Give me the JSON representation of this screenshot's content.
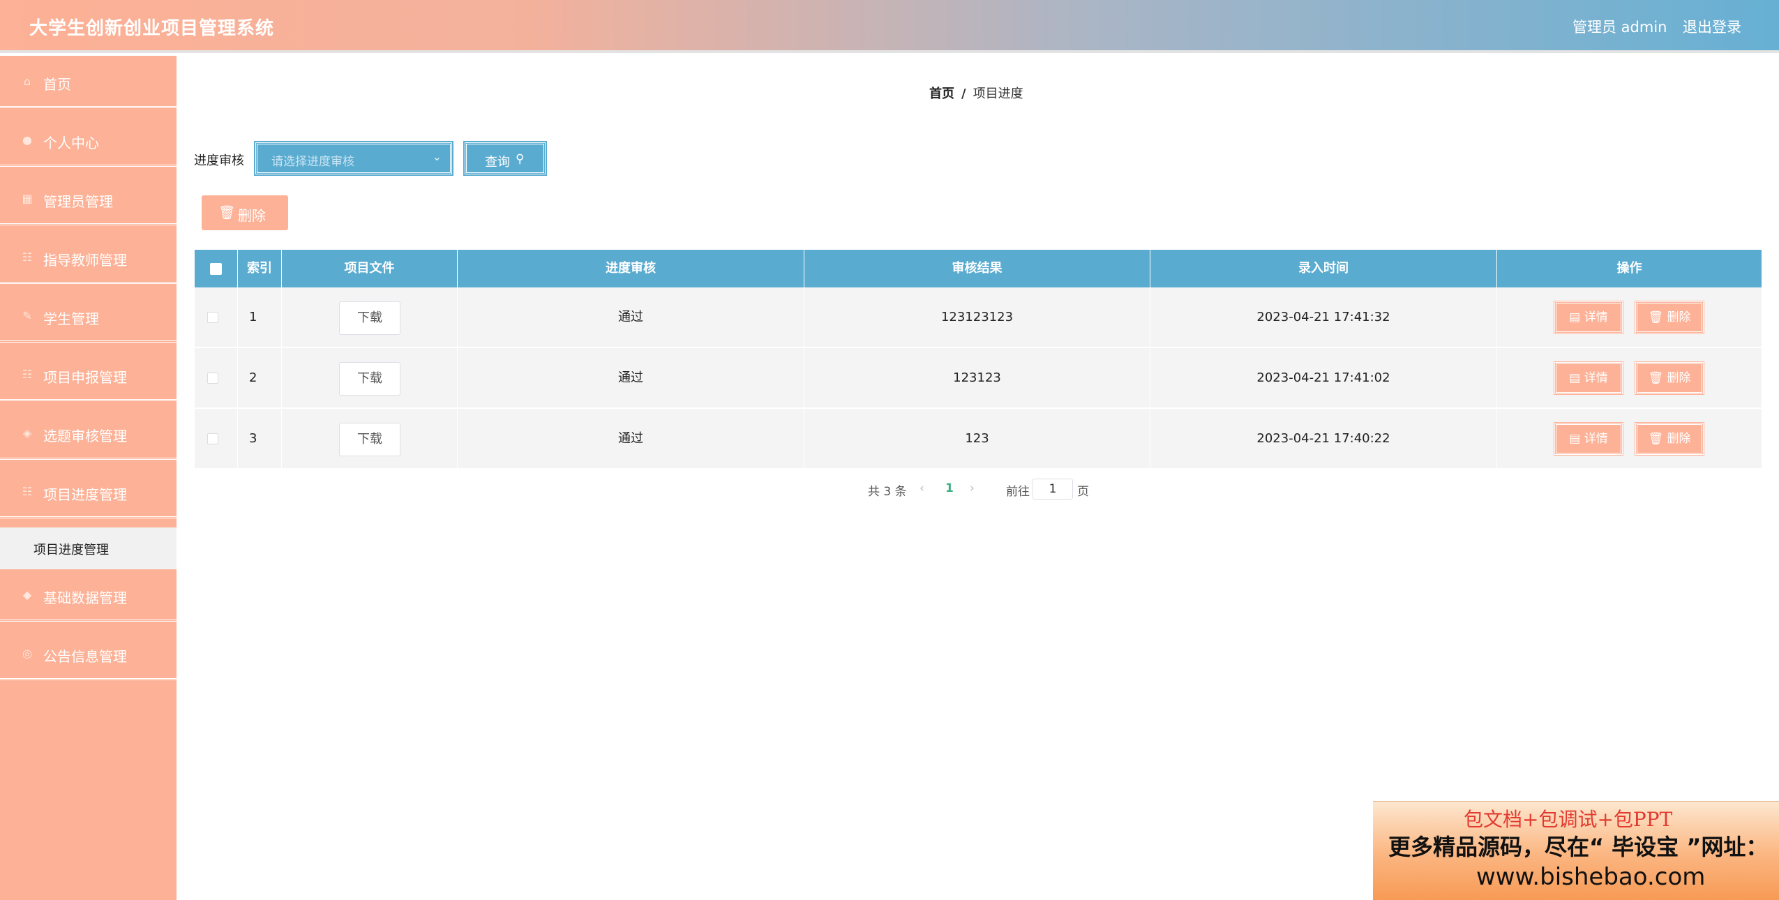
{
  "header": {
    "title": "大学生创新创业项目管理系统",
    "admin_label": "管理员 admin",
    "logout": "退出登录"
  },
  "sidebar": {
    "items": [
      {
        "label": "首页",
        "icon": "home-icon"
      },
      {
        "label": "个人中心",
        "icon": "user-icon"
      },
      {
        "label": "管理员管理",
        "icon": "grid-icon"
      },
      {
        "label": "指导教师管理",
        "icon": "list-icon"
      },
      {
        "label": "学生管理",
        "icon": "student-icon"
      },
      {
        "label": "项目申报管理",
        "icon": "list-icon"
      },
      {
        "label": "选题审核管理",
        "icon": "check-icon"
      },
      {
        "label": "项目进度管理",
        "icon": "list-icon"
      },
      {
        "label": "基础数据管理",
        "icon": "data-icon"
      },
      {
        "label": "公告信息管理",
        "icon": "notice-icon"
      }
    ],
    "sub_item": "项目进度管理"
  },
  "breadcrumb": {
    "home": "首页",
    "separator": "/",
    "current": "项目进度"
  },
  "filter": {
    "label": "进度审核",
    "placeholder": "请选择进度审核",
    "query_label": "查询"
  },
  "toolbar": {
    "delete_label": "删除"
  },
  "table": {
    "columns": [
      "索引",
      "项目文件",
      "进度审核",
      "审核结果",
      "录入时间",
      "操作"
    ],
    "rows": [
      {
        "index": "1",
        "file_btn": "下载",
        "status": "通过",
        "result": "123123123",
        "time": "2023-04-21 17:41:32"
      },
      {
        "index": "2",
        "file_btn": "下载",
        "status": "通过",
        "result": "123123",
        "time": "2023-04-21 17:41:02"
      },
      {
        "index": "3",
        "file_btn": "下载",
        "status": "通过",
        "result": "123",
        "time": "2023-04-21 17:40:22"
      }
    ],
    "detail_label": "详情",
    "row_delete_label": "删除"
  },
  "pagination": {
    "total": "共 3 条",
    "current_page": "1",
    "goto_label": "前往",
    "goto_value": "1",
    "page_unit": "页"
  },
  "ad": {
    "line1": "包文档+包调试+包PPT",
    "line2": "更多精品源码，尽在“ 毕设宝 ”网址：",
    "line3": "www.bishebao.com"
  },
  "colors": {
    "accent_blue": "#5aabd0",
    "accent_peach": "#fdb196",
    "current_page_green": "#3db081"
  }
}
